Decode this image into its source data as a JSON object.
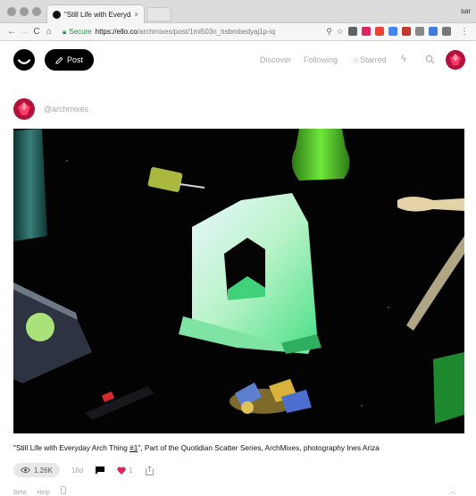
{
  "browser": {
    "tab_title": "\"Still Life with Everyday Arch T",
    "tab_close": "×",
    "profile": "sar",
    "nav": {
      "back": "←",
      "forward": "→",
      "reload": "C",
      "home": "⌂"
    },
    "url": {
      "secure_label": "Secure",
      "host": "https://ello.co",
      "path": "/archmixes/post/1mi503n_hsbmbedyaj1p-iq"
    },
    "omnibox_icons": {
      "search": "⚲",
      "star": "☆"
    },
    "extension_colors": [
      "#5f6368",
      "#e0245e",
      "#ea4335",
      "#4285f4",
      "#c0392b",
      "#888888",
      "#3b7ddd",
      "#777777"
    ]
  },
  "header": {
    "post_label": "Post",
    "nav": {
      "discover": "Discover",
      "following": "Following",
      "starred": "Starred"
    },
    "icons": {
      "star": "☆",
      "bolt": "ϟ"
    }
  },
  "post": {
    "author": "@archmixes",
    "caption_prefix": "\"Still Life with Everyday Arch Thing ",
    "caption_link": "#1",
    "caption_suffix": "\", Part of the Quotidian Scatter Series, ArchMixes, photography Ines Ariza",
    "views": "1.26K",
    "timestamp": "16d",
    "loves": "1"
  },
  "footer": {
    "beta": "Beta",
    "help": "Help"
  },
  "colors": {
    "accent_red": "#e0245e",
    "avatar_red": "#b3123a",
    "secure_green": "#1e8e3e"
  }
}
